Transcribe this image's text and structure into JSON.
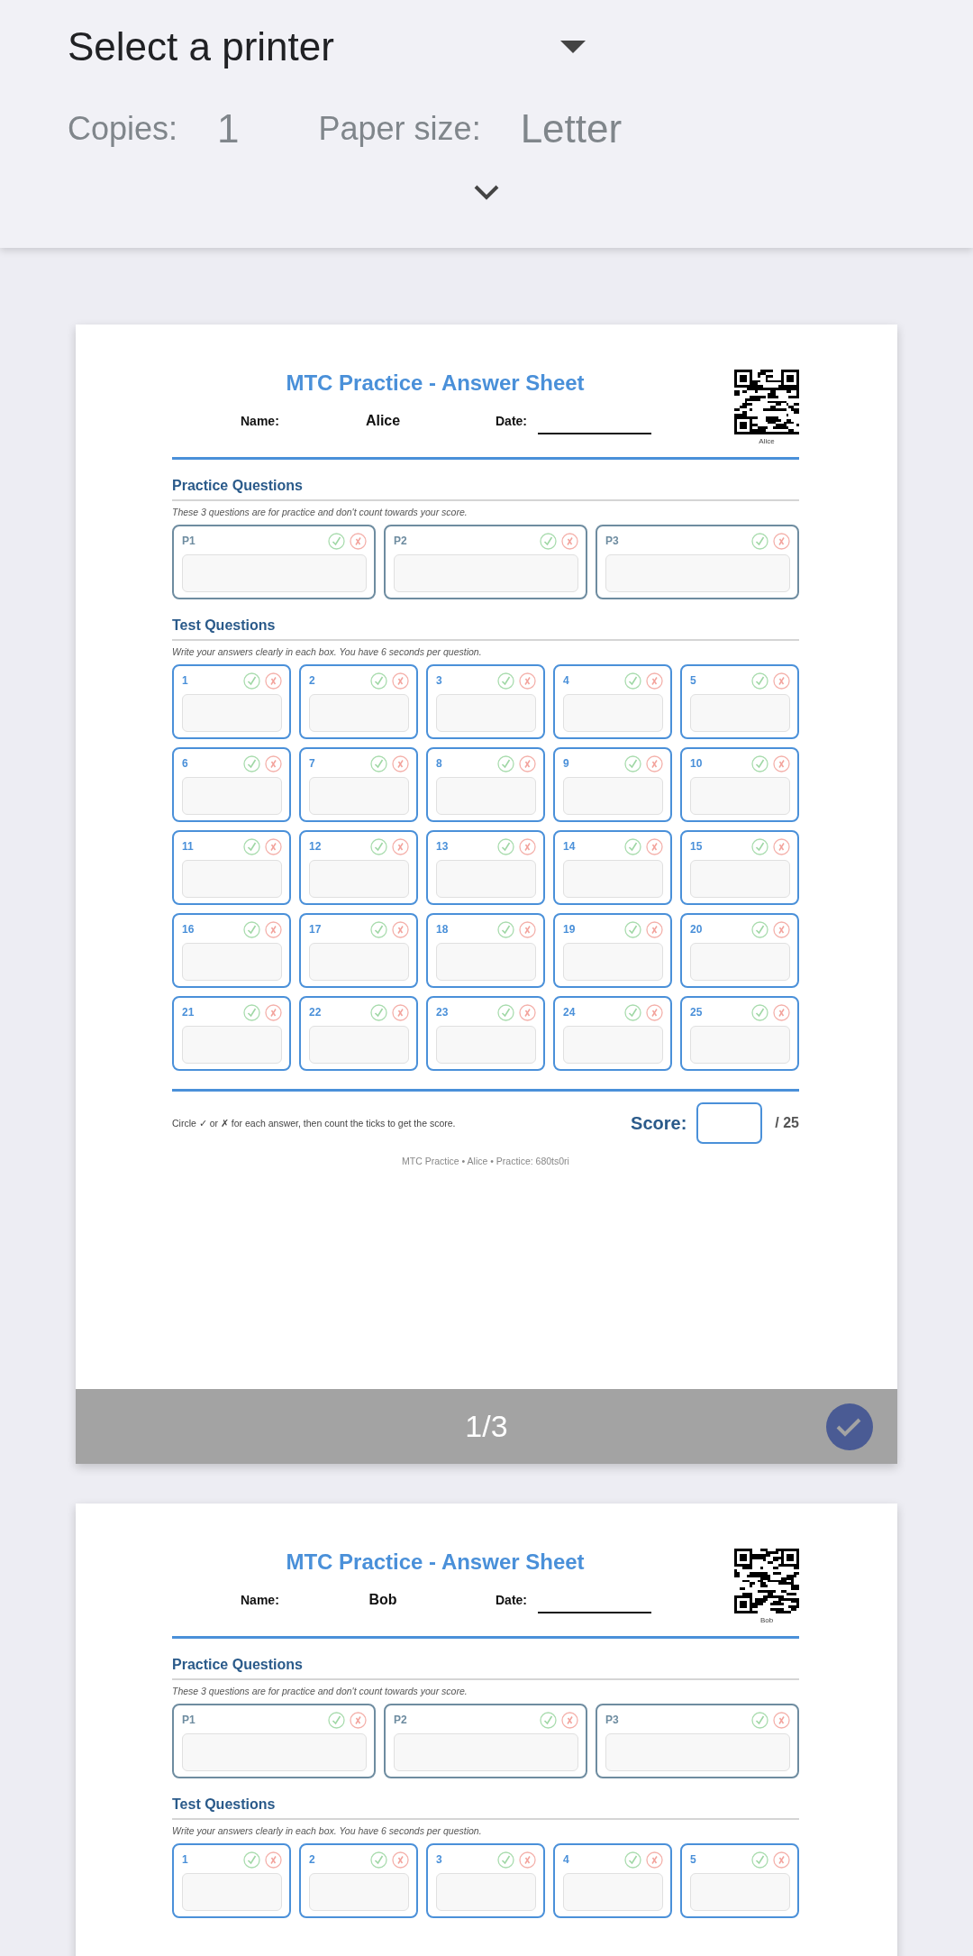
{
  "print_settings": {
    "printer": "Select a printer",
    "copies_label": "Copies:",
    "copies": "1",
    "paper_size_label": "Paper size:",
    "paper_size": "Letter"
  },
  "pages": [
    {
      "title": "MTC Practice - Answer Sheet",
      "name_label": "Name:",
      "name": "Alice",
      "date_label": "Date:",
      "qr_caption": "Alice",
      "sections": [
        {
          "kind": "practice",
          "heading": "Practice Questions",
          "note": "These 3 questions are for practice and don't count towards your score.",
          "questions": [
            "P1",
            "P2",
            "P3"
          ]
        },
        {
          "kind": "test",
          "heading": "Test Questions",
          "note": "Write your answers clearly in each box. You have 6 seconds per question.",
          "questions": [
            "1",
            "2",
            "3",
            "4",
            "5",
            "6",
            "7",
            "8",
            "9",
            "10",
            "11",
            "12",
            "13",
            "14",
            "15",
            "16",
            "17",
            "18",
            "19",
            "20",
            "21",
            "22",
            "23",
            "24",
            "25"
          ]
        }
      ],
      "footer": {
        "instructions": "Circle ✓ or ✗ for each answer, then count the ticks to get the score.",
        "score_label": "Score:",
        "score_total": "/ 25",
        "footnote": "MTC Practice • Alice • Practice: 680ts0ri"
      },
      "page_bar": {
        "label": "1/3",
        "selected": true
      }
    },
    {
      "title": "MTC Practice - Answer Sheet",
      "name_label": "Name:",
      "name": "Bob",
      "date_label": "Date:",
      "qr_caption": "Bob",
      "sections": [
        {
          "kind": "practice",
          "heading": "Practice Questions",
          "note": "These 3 questions are for practice and don't count towards your score.",
          "questions": [
            "P1",
            "P2",
            "P3"
          ]
        },
        {
          "kind": "test",
          "heading": "Test Questions",
          "note": "Write your answers clearly in each box. You have 6 seconds per question.",
          "questions": [
            "1",
            "2",
            "3",
            "4",
            "5"
          ]
        }
      ]
    }
  ]
}
